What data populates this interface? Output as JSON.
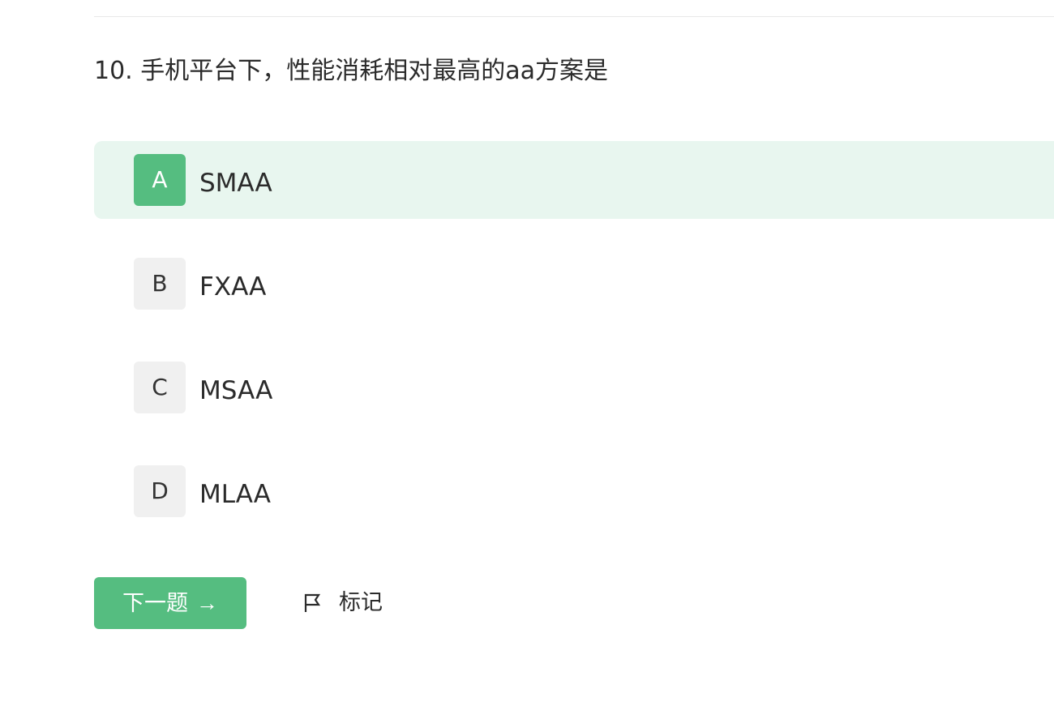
{
  "question": {
    "title": "10. 手机平台下，性能消耗相对最高的aa方案是",
    "selected": "A"
  },
  "options": [
    {
      "letter": "A",
      "text": "SMAA",
      "selected": true
    },
    {
      "letter": "B",
      "text": "FXAA",
      "selected": false
    },
    {
      "letter": "C",
      "text": "MSAA",
      "selected": false
    },
    {
      "letter": "D",
      "text": "MLAA",
      "selected": false
    }
  ],
  "actions": {
    "next_label": "下一题",
    "next_arrow": "→",
    "mark_label": "标记",
    "mark_icon": "flag-icon"
  },
  "colors": {
    "accent": "#55bd80",
    "selected_bg": "#e8f6ef",
    "letter_bg": "#f0f0f0",
    "text": "#2b2b2b"
  }
}
